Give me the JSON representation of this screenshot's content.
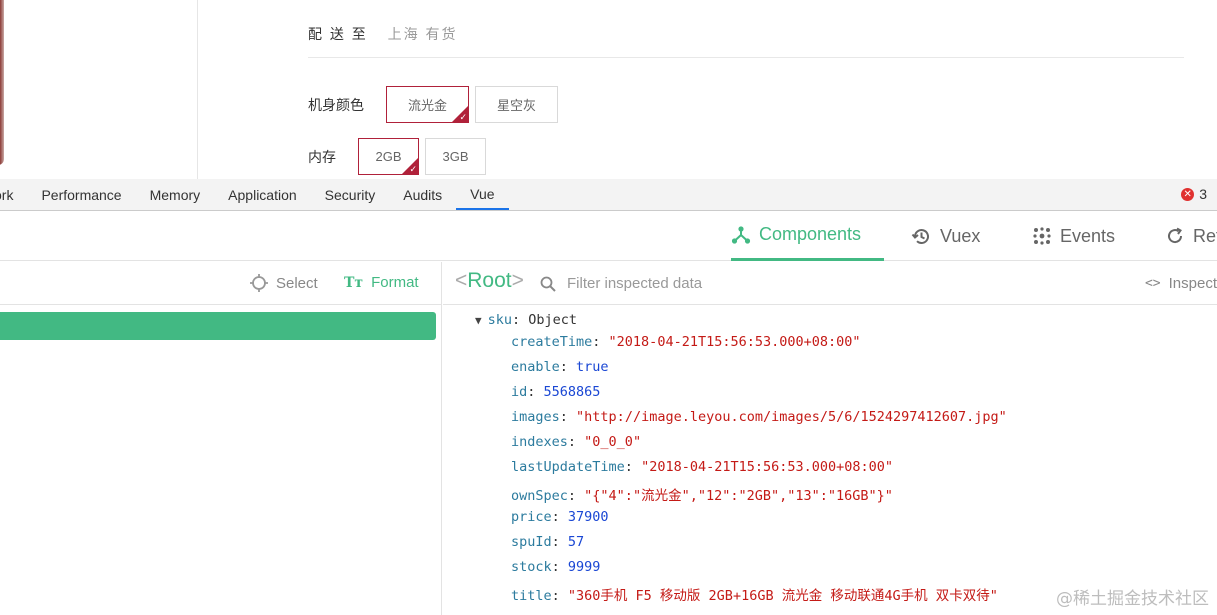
{
  "product": {
    "ship_label": "配 送 至",
    "ship_value": "上海 有货",
    "color_label": "机身颜色",
    "color_options": [
      "流光金",
      "星空灰"
    ],
    "memory_label": "内存",
    "memory_options": [
      "2GB",
      "3GB"
    ]
  },
  "devtools": {
    "tabs": [
      "ork",
      "Performance",
      "Memory",
      "Application",
      "Security",
      "Audits",
      "Vue"
    ],
    "active_tab": "Vue",
    "error_count": "3"
  },
  "vue": {
    "tabs": [
      {
        "label": "Components",
        "icon": "components-icon"
      },
      {
        "label": "Vuex",
        "icon": "history-icon"
      },
      {
        "label": "Events",
        "icon": "events-icon"
      },
      {
        "label": "Ref",
        "icon": "refresh-icon"
      }
    ],
    "active_tab": "Components",
    "select_label": "Select",
    "format_label": "Format",
    "root_label": "Root",
    "filter_placeholder": "Filter inspected data",
    "inspect_label": "Inspect"
  },
  "inspector": {
    "object_key": "sku",
    "object_type": "Object",
    "props": [
      {
        "key": "createTime",
        "value": "\"2018-04-21T15:56:53.000+08:00\"",
        "kind": "str"
      },
      {
        "key": "enable",
        "value": "true",
        "kind": "bool"
      },
      {
        "key": "id",
        "value": "5568865",
        "kind": "num"
      },
      {
        "key": "images",
        "value": "\"http://image.leyou.com/images/5/6/1524297412607.jpg\"",
        "kind": "str"
      },
      {
        "key": "indexes",
        "value": "\"0_0_0\"",
        "kind": "str"
      },
      {
        "key": "lastUpdateTime",
        "value": "\"2018-04-21T15:56:53.000+08:00\"",
        "kind": "str"
      },
      {
        "key": "ownSpec",
        "value": "\"{\"4\":\"流光金\",\"12\":\"2GB\",\"13\":\"16GB\"}\"",
        "kind": "str"
      },
      {
        "key": "price",
        "value": "37900",
        "kind": "num"
      },
      {
        "key": "spuId",
        "value": "57",
        "kind": "num"
      },
      {
        "key": "stock",
        "value": "9999",
        "kind": "num"
      },
      {
        "key": "title",
        "value": "\"360手机 F5 移动版 2GB+16GB 流光金 移动联通4G手机 双卡双待\"",
        "kind": "str"
      }
    ]
  },
  "watermark": "@稀土掘金技术社区",
  "colors": {
    "vue_green": "#42b983",
    "selected_border": "#b0213a",
    "active_tab_underline": "#1a73e8"
  }
}
